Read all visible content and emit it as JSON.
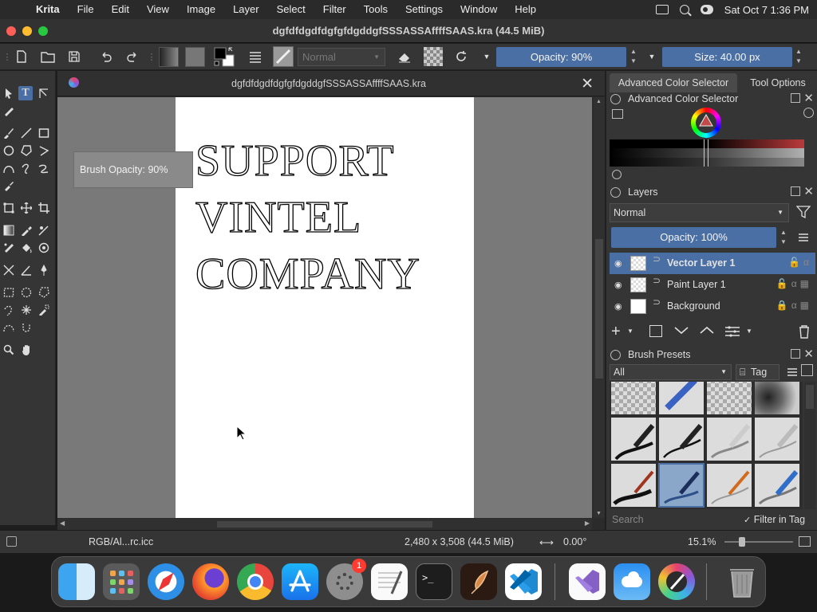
{
  "menubar": {
    "app": "Krita",
    "items": [
      "File",
      "Edit",
      "View",
      "Image",
      "Layer",
      "Select",
      "Filter",
      "Tools",
      "Settings",
      "Window",
      "Help"
    ],
    "clock": "Sat Oct 7  1:36 PM"
  },
  "window": {
    "title": "dgfdfdgdfdgfgfdgddgfSSSASSAffffSAAS.kra (44.5 MiB)"
  },
  "toolbar": {
    "blend_mode": "Normal",
    "opacity": "Opacity: 90%",
    "size": "Size: 40.00 px"
  },
  "document": {
    "tab_title": "dgfdfdgdfdgfgfdgddgfSSSASSAffffSAAS.kra",
    "canvas_lines": [
      "SUPPORT",
      "VINTEL",
      "COMPANY"
    ],
    "osd": "Brush Opacity: 90%"
  },
  "docker": {
    "tabs": [
      "Advanced Color Selector",
      "Tool Options"
    ],
    "color_selector_title": "Advanced Color Selector",
    "layers_title": "Layers",
    "layers_blend": "Normal",
    "layers_opacity": "Opacity:  100%",
    "layers": [
      {
        "name": "Vector Layer 1",
        "selected": true
      },
      {
        "name": "Paint Layer 1",
        "selected": false
      },
      {
        "name": "Background",
        "selected": false
      }
    ],
    "brush_presets_title": "Brush Presets",
    "brush_filter": "All",
    "tag_label": "Tag",
    "search_placeholder": "Search",
    "filter_in_tag": "Filter in Tag"
  },
  "statusbar": {
    "color_profile": "RGB/Al...rc.icc",
    "dimensions": "2,480 x 3,508 (44.5 MiB)",
    "rotation": "0.00°",
    "zoom": "15.1%"
  },
  "dock": {
    "apps": [
      "finder-icon",
      "launchpad-icon",
      "safari-icon",
      "firefox-icon",
      "chrome-icon",
      "app-store-icon",
      "system-settings-icon",
      "textedit-icon",
      "terminal-icon",
      "garageband-icon",
      "vscode-icon",
      "visual-studio-icon",
      "weather-icon",
      "krita-icon",
      "trash-icon"
    ],
    "settings_badge": "1"
  },
  "colors": {
    "accent": "#4a6fa5",
    "canvas_gray": "#797979",
    "panel": "#353535"
  }
}
